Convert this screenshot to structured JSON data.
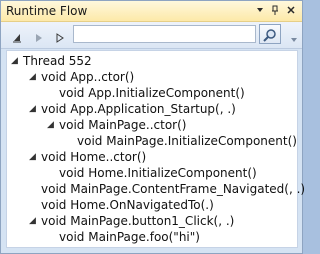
{
  "window": {
    "title": "Runtime Flow",
    "buttons": [
      "dropdown-icon",
      "pin-icon",
      "close-icon"
    ]
  },
  "toolbar": {
    "search_value": "",
    "tools": [
      "step-first-icon",
      "step-prev-icon",
      "step-next-icon"
    ]
  },
  "tree": {
    "items": [
      {
        "label": "Thread 552",
        "level": 0,
        "expanded": true
      },
      {
        "label": "void App..ctor()",
        "level": 1,
        "expanded": true
      },
      {
        "label": "void App.InitializeComponent()",
        "level": 2,
        "expanded": false
      },
      {
        "label": "void App.Application_Startup(, .)",
        "level": 1,
        "expanded": true
      },
      {
        "label": "void MainPage..ctor()",
        "level": 2,
        "expanded": true
      },
      {
        "label": "void MainPage.InitializeComponent()",
        "level": 3,
        "expanded": false
      },
      {
        "label": "void Home..ctor()",
        "level": 1,
        "expanded": true
      },
      {
        "label": "void Home.InitializeComponent()",
        "level": 2,
        "expanded": false
      },
      {
        "label": "void MainPage.ContentFrame_Navigated(, .)",
        "level": 1,
        "expanded": false
      },
      {
        "label": "void Home.OnNavigatedTo(.)",
        "level": 1,
        "expanded": false
      },
      {
        "label": "void MainPage.button1_Click(, .)",
        "level": 1,
        "expanded": true
      },
      {
        "label": "void MainPage.foo(\"hi\")",
        "level": 2,
        "expanded": false
      }
    ]
  }
}
